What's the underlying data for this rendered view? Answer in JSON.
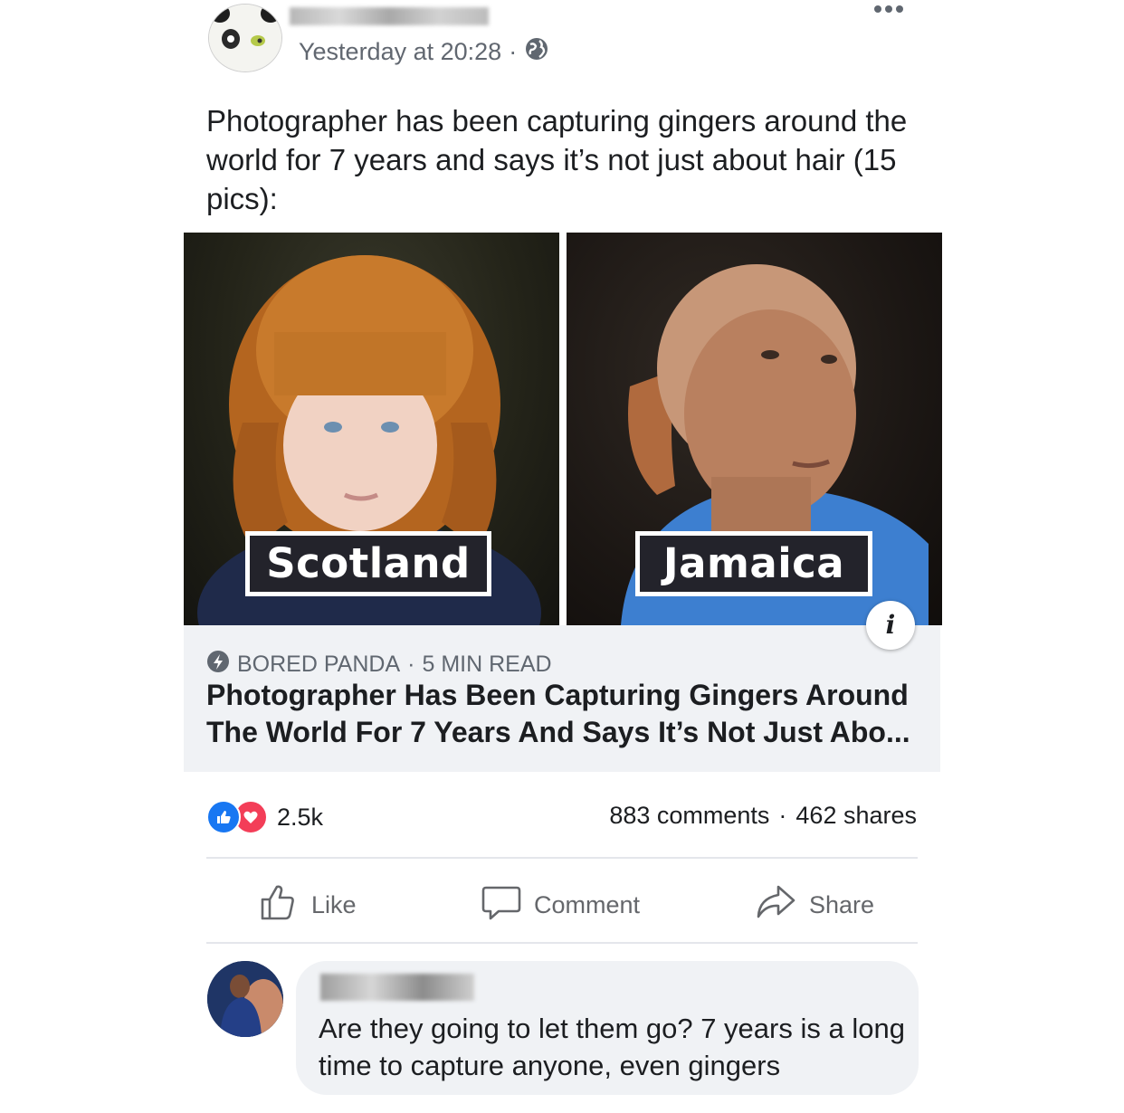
{
  "post": {
    "timestamp": "Yesterday at 20:28",
    "separator": "·",
    "text": "Photographer has been capturing gingers around the world for 7 years and says it’s not just about hair (15 pics):"
  },
  "link_preview": {
    "labels": {
      "left": "Scotland",
      "right": "Jamaica"
    },
    "info_glyph": "i",
    "source": "BORED PANDA",
    "read_time": "5 MIN READ",
    "separator": "·",
    "headline": "Photographer Has Been Capturing Gingers Around The World For 7 Years And Says It’s Not Just Abo..."
  },
  "engagement": {
    "reaction_count": "2.5k",
    "comments": "883 comments",
    "separator": "·",
    "shares": "462 shares"
  },
  "actions": {
    "like": "Like",
    "comment": "Comment",
    "share": "Share"
  },
  "comment": {
    "text": "Are they going to let them go? 7 years is a long time to capture anyone, even gingers"
  },
  "colors": {
    "like_blue": "#1877f2",
    "love_red": "#f33e58",
    "preview_bg": "#f0f2f5",
    "label_bg": "#23232b"
  },
  "icons": {
    "more": "more-dots-icon",
    "privacy": "globe-icon",
    "source": "bored-panda-logo-icon",
    "like_reaction": "like-reaction-icon",
    "love_reaction": "love-reaction-icon",
    "like_action": "thumbs-up-icon",
    "comment_action": "speech-bubble-icon",
    "share_action": "share-arrow-icon"
  }
}
